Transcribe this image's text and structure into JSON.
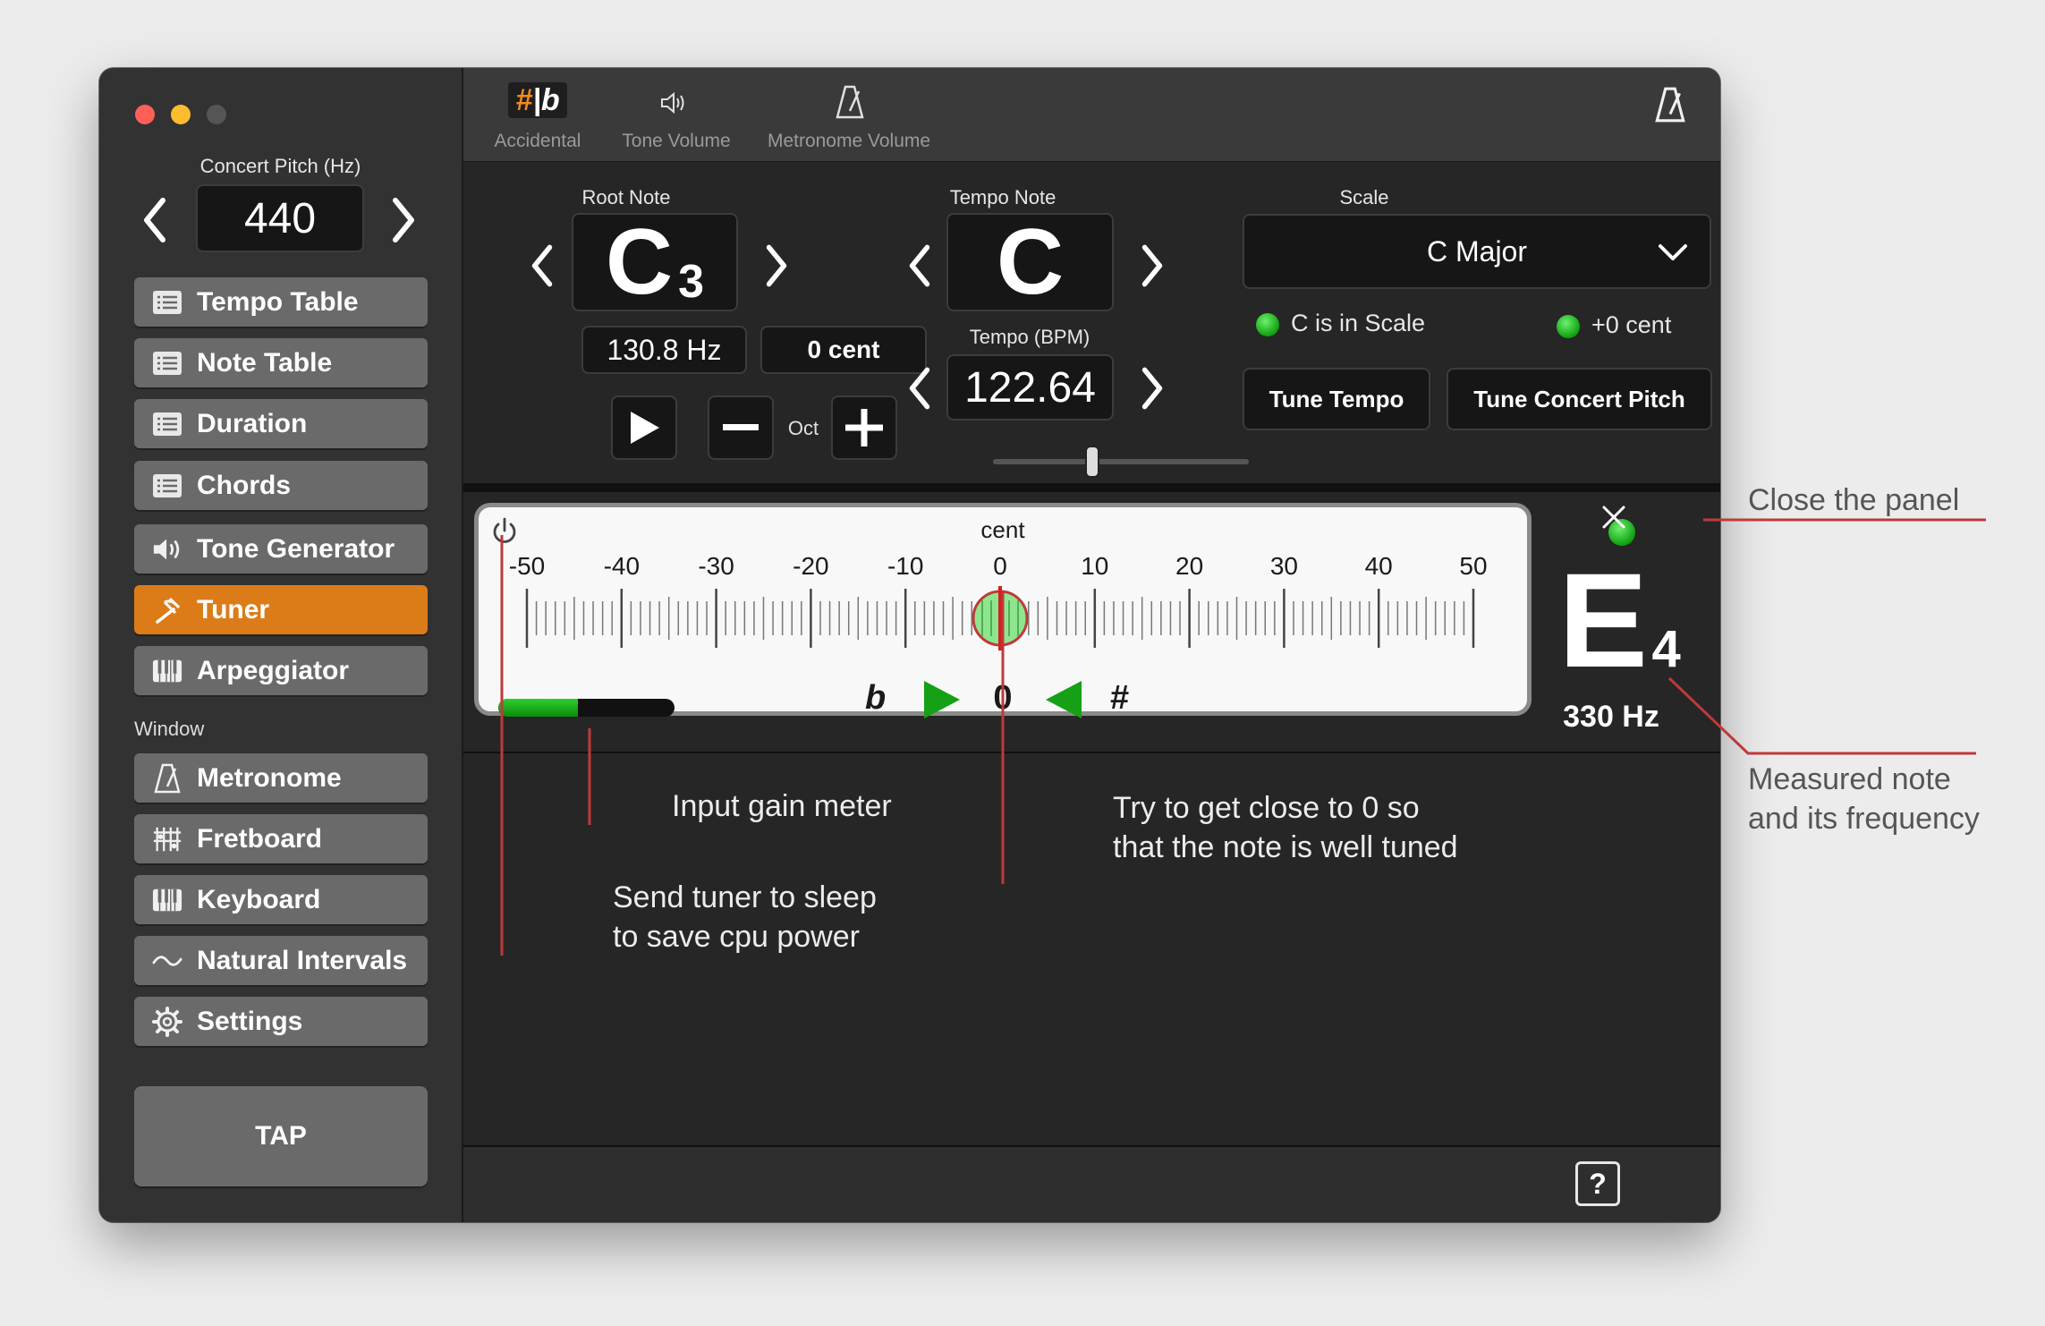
{
  "sidebar": {
    "concert_pitch_label": "Concert Pitch (Hz)",
    "concert_pitch_value": "440",
    "nav": [
      {
        "label": "Tempo Table",
        "icon": "list-icon"
      },
      {
        "label": "Note Table",
        "icon": "list-icon"
      },
      {
        "label": "Duration",
        "icon": "list-icon"
      },
      {
        "label": "Chords",
        "icon": "list-icon"
      },
      {
        "label": "Tone Generator",
        "icon": "speaker-icon"
      },
      {
        "label": "Tuner",
        "icon": "tuning-fork-icon",
        "active": true
      },
      {
        "label": "Arpeggiator",
        "icon": "piano-icon"
      }
    ],
    "window_section_label": "Window",
    "window_items": [
      {
        "label": "Metronome",
        "icon": "metronome-icon"
      },
      {
        "label": "Fretboard",
        "icon": "fretboard-icon"
      },
      {
        "label": "Keyboard",
        "icon": "piano-icon"
      },
      {
        "label": "Natural Intervals",
        "icon": "wave-icon"
      },
      {
        "label": "Settings",
        "icon": "gear-icon"
      }
    ],
    "tap_label": "TAP"
  },
  "toolbar": {
    "accidental_label": "Accidental",
    "accidental_glyph": "#|b",
    "tone_volume_label": "Tone Volume",
    "metronome_volume_label": "Metronome Volume"
  },
  "controls": {
    "root_note_label": "Root Note",
    "root_note": "C",
    "root_octave": "3",
    "root_freq": "130.8 Hz",
    "root_cent": "0 cent",
    "oct_label": "Oct",
    "tempo_note_label": "Tempo Note",
    "tempo_note": "C",
    "tempo_bpm_label": "Tempo (BPM)",
    "tempo_bpm": "122.64",
    "tempo_slider_fraction": 0.38,
    "scale_label": "Scale",
    "scale_value": "C Major",
    "in_scale_text": "C is in Scale",
    "cent_offset_text": "+0 cent",
    "tune_tempo_label": "Tune Tempo",
    "tune_concert_pitch_label": "Tune Concert Pitch"
  },
  "tuner": {
    "cent_label": "cent",
    "scale_labels": [
      "-50",
      "-40",
      "-30",
      "-20",
      "-10",
      "0",
      "10",
      "20",
      "30",
      "40",
      "50"
    ],
    "flat_symbol": "b",
    "sharp_symbol": "#",
    "deviation_value": "0",
    "gain_fraction": 0.45,
    "note": "E",
    "octave": "4",
    "frequency": "330 Hz",
    "help_label": "?"
  },
  "annotations": {
    "close_panel": "Close the panel",
    "measured_line1": "Measured note",
    "measured_line2": "and its frequency",
    "gain_meter": "Input gain meter",
    "try_line1": "Try to get close to 0 so",
    "try_line2": "that the note is well tuned",
    "sleep_line1": "Send tuner to sleep",
    "sleep_line2": "to save cpu power"
  },
  "colors": {
    "accent": "#dc7c19",
    "annotation_line": "#c0393b",
    "green": "#16a016"
  }
}
